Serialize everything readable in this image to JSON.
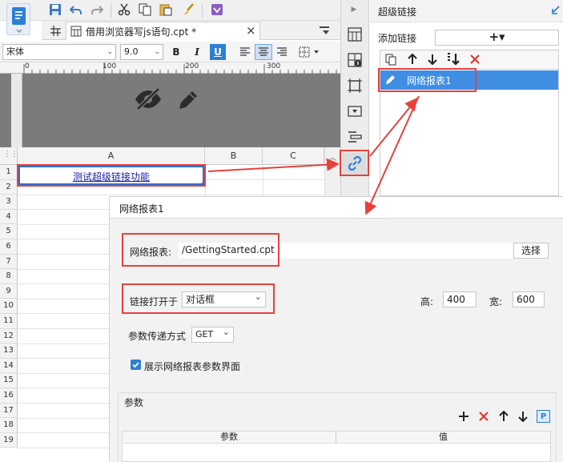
{
  "editor": {
    "tab_title": "借用浏览器写js语句.cpt *",
    "tab_close": "×",
    "font_name": "宋体",
    "font_size": "9.0",
    "ruler": {
      "t0": "0",
      "t100": "100",
      "t200": "200",
      "t300": "300"
    },
    "columns": [
      "A",
      "B",
      "C"
    ],
    "rows": [
      "1",
      "2",
      "3",
      "4",
      "5",
      "6",
      "7",
      "8",
      "9",
      "10",
      "11",
      "12",
      "13",
      "14",
      "15",
      "16",
      "17",
      "18",
      "19"
    ],
    "cell_a1": "测试超级链接功能"
  },
  "right_panel": {
    "title": "超级链接",
    "add_label": "添加链接",
    "add_button": "+▾",
    "items": [
      {
        "label": "网络报表1"
      }
    ]
  },
  "dialog": {
    "title": "网络报表1",
    "report_label": "网络报表:",
    "report_value": "/GettingStarted.cpt",
    "choose_button": "选择",
    "open_in_label": "链接打开于",
    "open_in_value": "对话框",
    "height_label": "高:",
    "height_value": "400",
    "width_label": "宽:",
    "width_value": "600",
    "param_method_label": "参数传递方式",
    "param_method_value": "GET",
    "show_params_label": "展示网络报表参数界面",
    "show_params_checked": true,
    "params_section": "参数",
    "params_columns": [
      "参数",
      "值"
    ]
  },
  "colors": {
    "accent": "#3f8ee4",
    "highlight_box": "#e8403a",
    "link_text": "#1a1aa6",
    "sidebar_link_icon": "#2a7bd5"
  }
}
